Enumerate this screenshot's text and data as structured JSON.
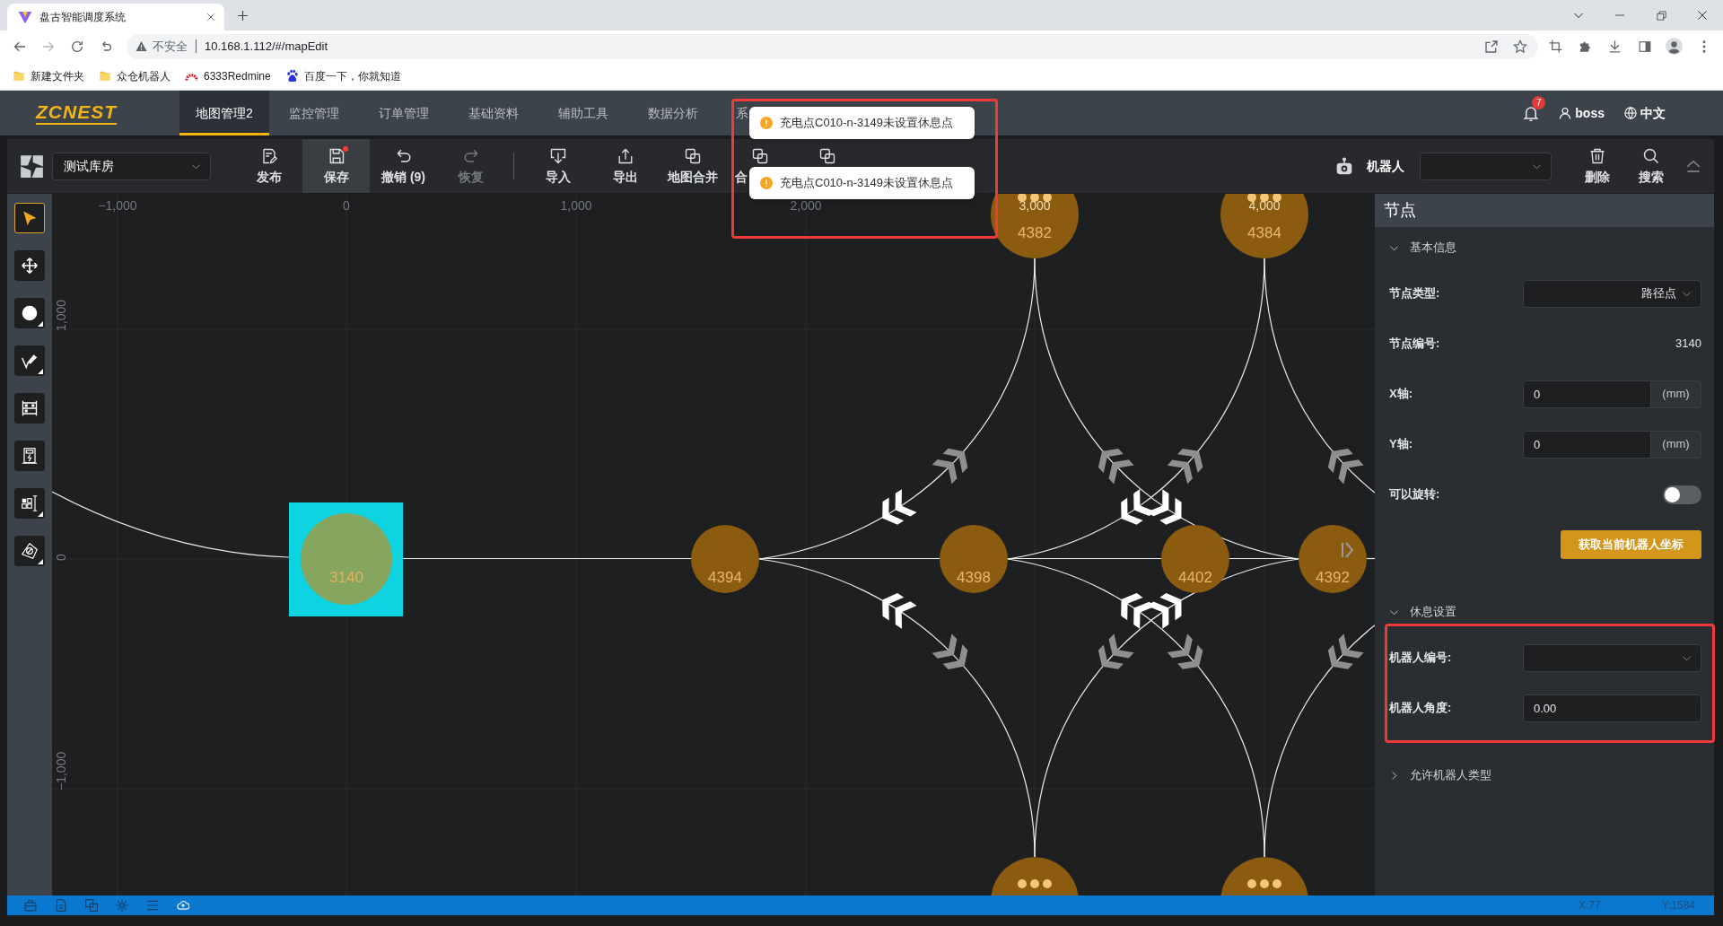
{
  "browser": {
    "tab": {
      "title": "盘古智能调度系统"
    },
    "address": {
      "security": "不安全",
      "url": "10.168.1.112/#/mapEdit"
    },
    "bookmarks": [
      {
        "kind": "folder",
        "label": "新建文件夹"
      },
      {
        "kind": "folder",
        "label": "众仓机器人"
      },
      {
        "kind": "site",
        "label": "6333Redmine"
      },
      {
        "kind": "site",
        "label": "百度一下，你就知道"
      }
    ]
  },
  "header": {
    "logo": "ZCNEST",
    "nav": [
      {
        "label": "地图管理2",
        "selected": true,
        "cut": false
      },
      {
        "label": "监控管理",
        "selected": false,
        "cut": false
      },
      {
        "label": "订单管理",
        "selected": false,
        "cut": false
      },
      {
        "label": "基础资料",
        "selected": false,
        "cut": false
      },
      {
        "label": "辅助工具",
        "selected": false,
        "cut": false
      },
      {
        "label": "数据分析",
        "selected": false,
        "cut": false
      },
      {
        "label": "系",
        "selected": false,
        "cut": true
      }
    ],
    "notifications": "7",
    "user": "boss",
    "language": "中文"
  },
  "toolbar": {
    "warehouse": "测试库房",
    "action_groups": [
      [
        {
          "label": "发布",
          "active": false,
          "disabled": false,
          "dot": false
        },
        {
          "label": "保存",
          "active": true,
          "disabled": false,
          "dot": true
        },
        {
          "label": "撤销 (9)",
          "active": false,
          "disabled": false,
          "dot": false
        },
        {
          "label": "恢复",
          "active": false,
          "disabled": true,
          "dot": false
        }
      ],
      [
        {
          "label": "导入",
          "active": false,
          "disabled": false,
          "dot": false
        },
        {
          "label": "导出",
          "active": false,
          "disabled": false,
          "dot": false
        },
        {
          "label": "地图合并",
          "active": false,
          "disabled": false,
          "dot": false
        },
        {
          "label": "合",
          "active": false,
          "disabled": false,
          "dot": false,
          "cut": true
        },
        {
          "active": false,
          "disabled": false,
          "dot": false
        }
      ]
    ],
    "robot_label": "机器人",
    "right_actions": [
      {
        "label": "删除"
      },
      {
        "label": "搜索"
      }
    ]
  },
  "toasts": [
    {
      "message": "充电点C010-n-3149未设置休息点"
    },
    {
      "message": "充电点C010-n-3149未设置休息点"
    }
  ],
  "tools": [
    {
      "selected": true,
      "submenu": false
    },
    {
      "selected": false,
      "submenu": false
    },
    {
      "selected": false,
      "submenu": true
    },
    {
      "selected": false,
      "submenu": true
    },
    {
      "selected": false,
      "submenu": false
    },
    {
      "selected": false,
      "submenu": false
    },
    {
      "selected": false,
      "submenu": true
    },
    {
      "selected": false,
      "submenu": true
    }
  ],
  "map": {
    "x_ruler": [
      "−1,000",
      "0",
      "1,000",
      "2,000",
      "3,000",
      "4,000"
    ],
    "y_ruler": [
      "1,000",
      "0",
      "−1,000"
    ],
    "nodes": [
      {
        "label": "3140",
        "selected": true,
        "stacked": false,
        "marker": false
      },
      {
        "label": "4394",
        "selected": false,
        "stacked": false,
        "marker": false
      },
      {
        "label": "4398",
        "selected": false,
        "stacked": false,
        "marker": false
      },
      {
        "label": "4402",
        "selected": false,
        "stacked": false,
        "marker": false
      },
      {
        "label": "4392",
        "selected": false,
        "stacked": false,
        "marker": true
      },
      {
        "label": "4382",
        "selected": false,
        "stacked": true,
        "marker": false
      },
      {
        "label": "4384",
        "selected": false,
        "stacked": true,
        "marker": false
      },
      {
        "selected": false,
        "stacked": true,
        "marker": false
      },
      {
        "selected": false,
        "stacked": true,
        "marker": false
      }
    ]
  },
  "panel": {
    "title": "节点",
    "sections": [
      {
        "title": "基本信息",
        "expanded": true,
        "fields": [
          {
            "kind": "select",
            "label": "节点类型:",
            "value": "路径点"
          },
          {
            "kind": "text",
            "label": "节点编号:",
            "value": "3140"
          },
          {
            "kind": "input",
            "label": "X轴:",
            "value": "0",
            "unit": "(mm)"
          },
          {
            "kind": "input",
            "label": "Y轴:",
            "value": "0",
            "unit": "(mm)"
          },
          {
            "kind": "toggle",
            "label": "可以旋转:",
            "on": false
          },
          {
            "kind": "button",
            "label": "获取当前机器人坐标"
          }
        ]
      },
      {
        "title": "休息设置",
        "expanded": true,
        "fields": [
          {
            "kind": "select",
            "label": "机器人编号:"
          },
          {
            "kind": "input",
            "label": "机器人角度:",
            "value": "0.00"
          }
        ]
      },
      {
        "title": "允许机器人类型",
        "expanded": false
      }
    ]
  },
  "status_bar": {
    "x": "X:77",
    "y": "Y:1584"
  }
}
